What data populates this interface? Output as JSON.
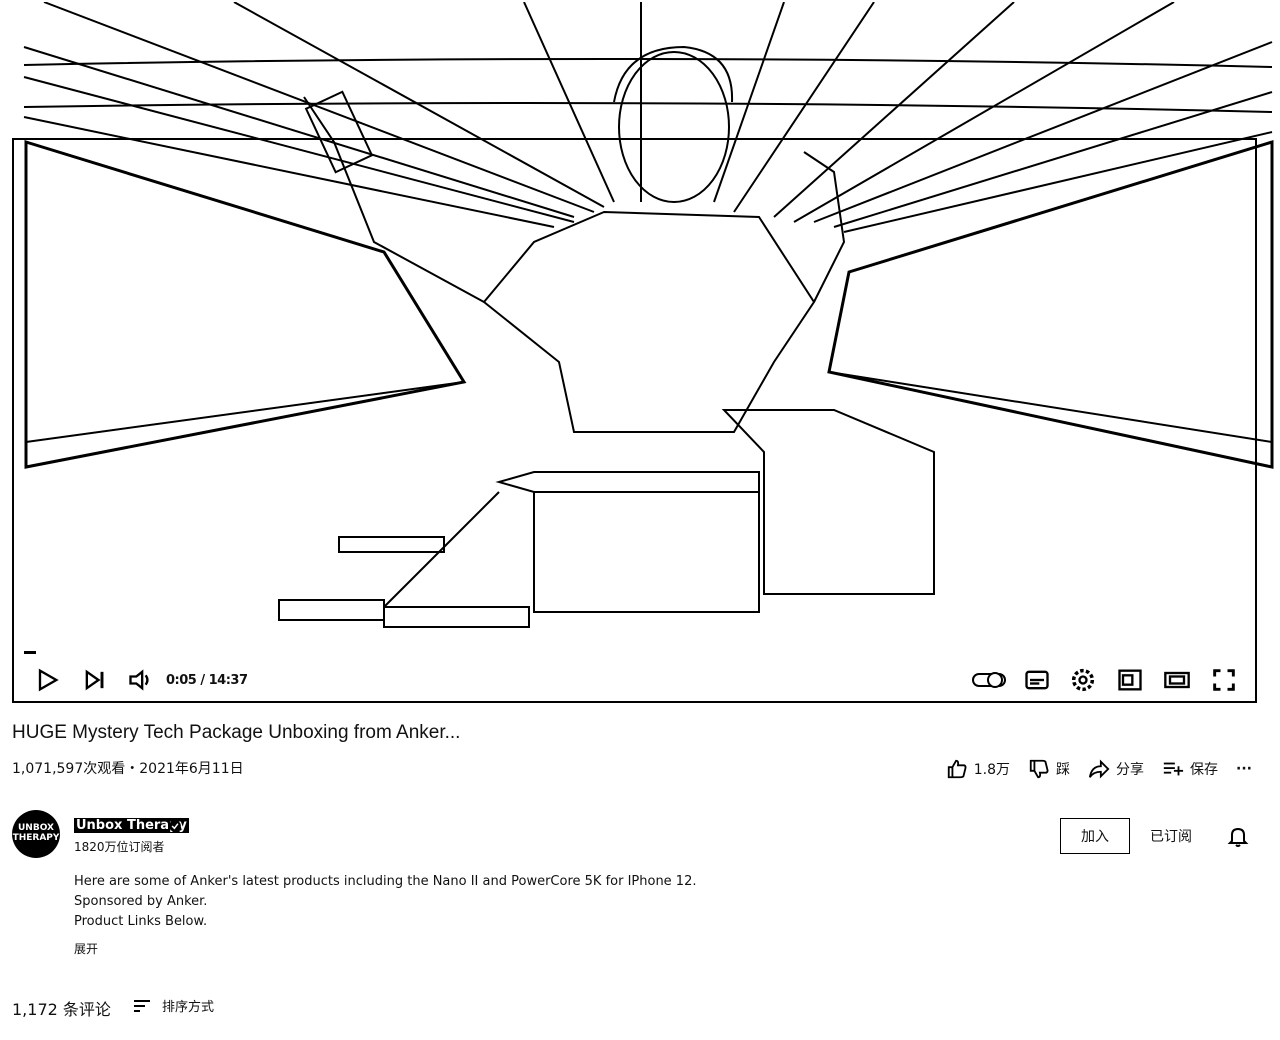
{
  "player": {
    "time_display": "0:05 / 14:37",
    "progress_fraction": 0.006
  },
  "video": {
    "title": "HUGE Mystery Tech Package Unboxing from Anker...",
    "stats": "1,071,597次观看・2021年6月11日"
  },
  "actions": {
    "like_count": "1.8万",
    "dislike_label": "踩",
    "share_label": "分享",
    "save_label": "保存",
    "more_label": "···"
  },
  "channel": {
    "name": "Unbox Therapy",
    "avatar_text": "UNBOX THERAPY",
    "subscribers": "1820万位订阅者",
    "join_label": "加入",
    "subscribed_label": "已订阅"
  },
  "description": {
    "lines": [
      "Here are some of Anker's latest products including the Nano II and PowerCore 5K for IPhone 12.",
      "Sponsored by Anker.",
      "Product Links Below."
    ],
    "show_more": "展开"
  },
  "comments": {
    "count_label": "1,172 条评论",
    "sort_label": "排序方式"
  }
}
